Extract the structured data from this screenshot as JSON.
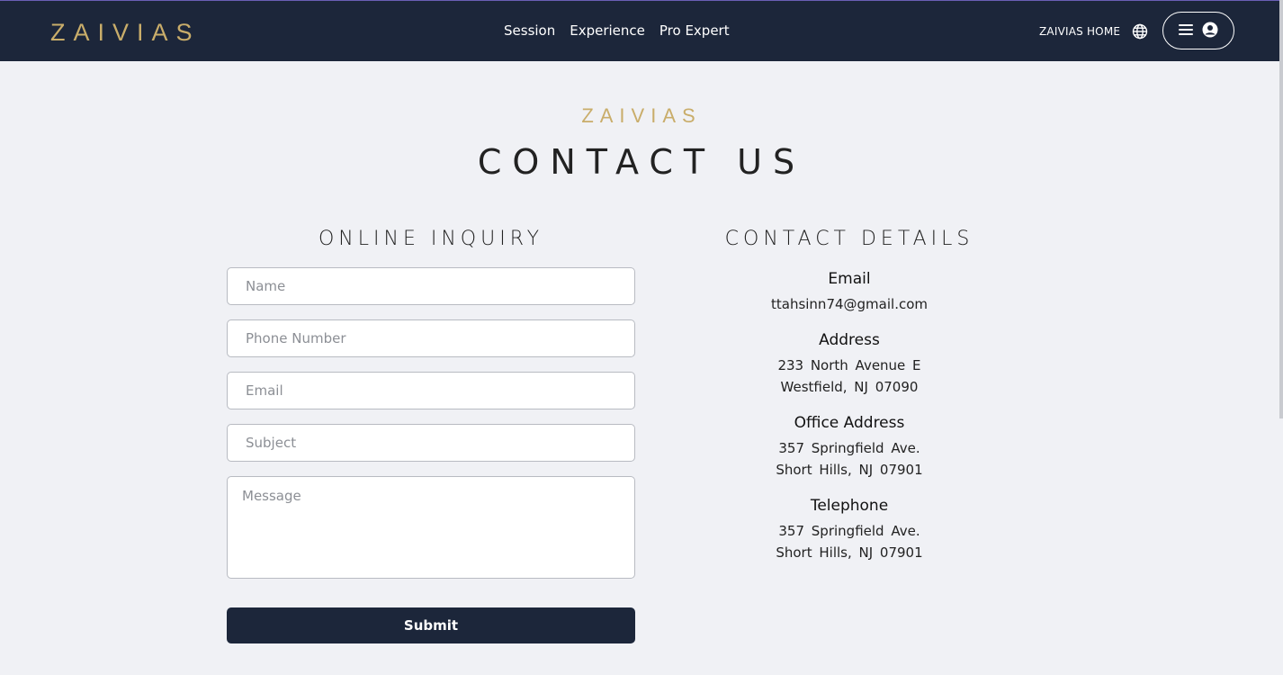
{
  "header": {
    "logo": "ZAIVIAS",
    "nav": [
      "Session",
      "Experience",
      "Pro Expert"
    ],
    "home_link": "ZAIVIAS HOME",
    "icons": {
      "globe": "globe-icon",
      "menu": "hamburger-icon",
      "user": "user-circle-icon"
    }
  },
  "hero": {
    "brand": "ZAIVIAS",
    "title": "CONTACT US"
  },
  "inquiry": {
    "title": "ONLINE INQUIRY",
    "placeholders": {
      "name": "Name",
      "phone": "Phone Number",
      "email": "Email",
      "subject": "Subject",
      "message": "Message"
    },
    "submit_label": "Submit"
  },
  "details": {
    "title": "CONTACT DETAILS",
    "email": {
      "label": "Email",
      "lines": [
        "ttahsinn74@gmail.com"
      ]
    },
    "address": {
      "label": "Address",
      "lines": [
        "233 North Avenue E",
        "Westfield, NJ 07090"
      ]
    },
    "office": {
      "label": "Office Address",
      "lines": [
        "357 Springfield Ave.",
        "Short Hills, NJ 07901"
      ]
    },
    "telephone": {
      "label": "Telephone",
      "lines": [
        "357 Springfield Ave.",
        "Short Hills, NJ 07901"
      ]
    }
  },
  "colors": {
    "navbar": "#1c263a",
    "gold": "#c9ad6a",
    "background": "#f0f1f5"
  }
}
